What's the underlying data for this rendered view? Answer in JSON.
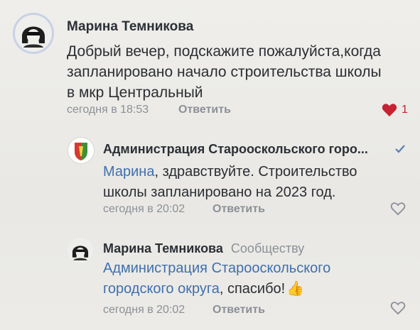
{
  "comments": [
    {
      "author": "Марина Темникова",
      "text_lines": [
        "Добрый вечер, подскажите пожалуйста,когда",
        "запланировано начало строительства школы",
        "в мкр Центральный"
      ],
      "time": "сегодня в 18:53",
      "reply_label": "Ответить",
      "likes": "1"
    },
    {
      "author": "Администрация Старооскольского горо...",
      "verified_mark": "✓",
      "mention": "Марина",
      "text_after_mention_line1": ", здравствуйте. Строительство",
      "text_line2": "школы запланировано на 2023 год.",
      "time": "сегодня в 20:02",
      "reply_label": "Ответить"
    },
    {
      "author": "Марина Темникова",
      "community_label": "Сообществу",
      "mention_line1": "Администрация Старооскольского",
      "mention_line2": "городского округа",
      "text_after_mention": ", спасибо!",
      "emoji": "👍",
      "time": "сегодня в 20:02",
      "reply_label": "Ответить"
    }
  ],
  "colors": {
    "accent_link": "#3f6fae",
    "like_red": "#c62232",
    "meta_gray": "#8b9098"
  },
  "icons": [
    "heart-icon",
    "verified-check-icon",
    "heart-outline-icon",
    "thumbs-up-emoji"
  ]
}
